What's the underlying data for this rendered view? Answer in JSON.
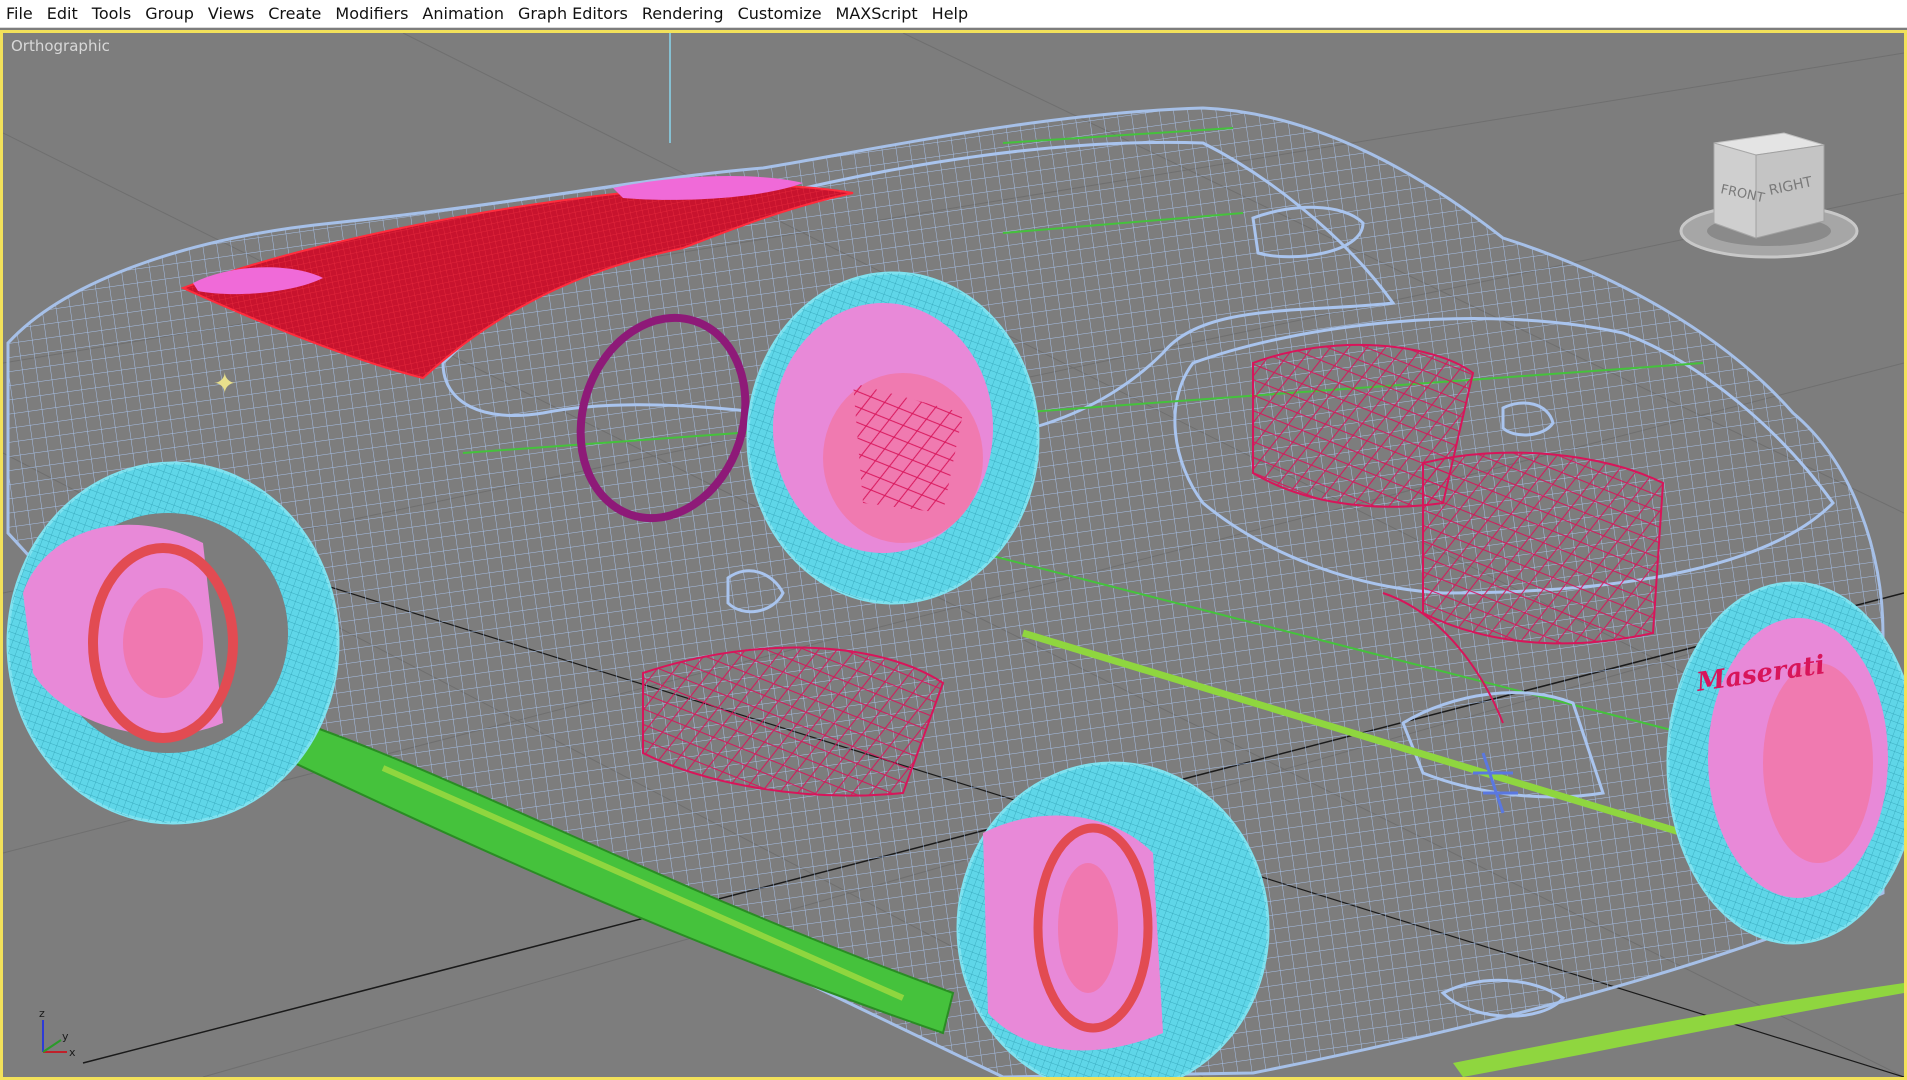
{
  "menu": [
    "File",
    "Edit",
    "Tools",
    "Group",
    "Views",
    "Create",
    "Modifiers",
    "Animation",
    "Graph Editors",
    "Rendering",
    "Customize",
    "MAXScript",
    "Help"
  ],
  "viewport": {
    "label": "Orthographic",
    "border_color": "#f2e15a",
    "background": "#7d7d7d"
  },
  "viewcube": {
    "front": "FRONT",
    "right": "RIGHT"
  },
  "axis": {
    "x": "x",
    "y": "y",
    "z": "z"
  },
  "model": {
    "badge": "Maserati",
    "colors": {
      "body_wire": "#a9c4ee",
      "tire": "#5fd6e8",
      "disc": "#e889d8",
      "brake_ring": "#e24b52",
      "roof": "#c8132e",
      "interior": "#d8155a",
      "chassis": "#45c23c",
      "sill": "#8fd63f",
      "steering": "#8e1a78"
    }
  }
}
